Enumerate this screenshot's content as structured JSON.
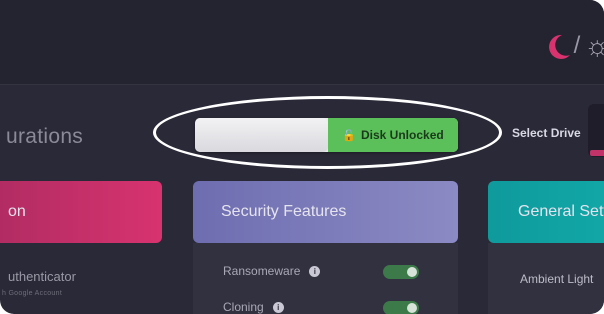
{
  "header": {
    "theme_slash": "/",
    "sun_glyph": "☼",
    "moon_color": "#d9336f"
  },
  "section": {
    "title": "urations"
  },
  "disk_toggle": {
    "label": "Disk Unlocked",
    "lock_glyph": "🔓",
    "state_color": "#5cc05a"
  },
  "drive": {
    "select_label": "Select Drive"
  },
  "cards": {
    "left": {
      "title": "on",
      "color": "#c82f69"
    },
    "security": {
      "title": "Security Features",
      "color": "#7c7bbb"
    },
    "general": {
      "title": "General Setti",
      "color": "#10a0a2"
    }
  },
  "authenticator": {
    "title": "uthenticator",
    "subtitle": "h Google Account"
  },
  "security_features": [
    {
      "label": "Ransomeware",
      "info": "i",
      "enabled": true
    },
    {
      "label": "Cloning",
      "info": "i",
      "enabled": true
    }
  ],
  "general_settings": {
    "ambient_label": "Ambient Light"
  }
}
